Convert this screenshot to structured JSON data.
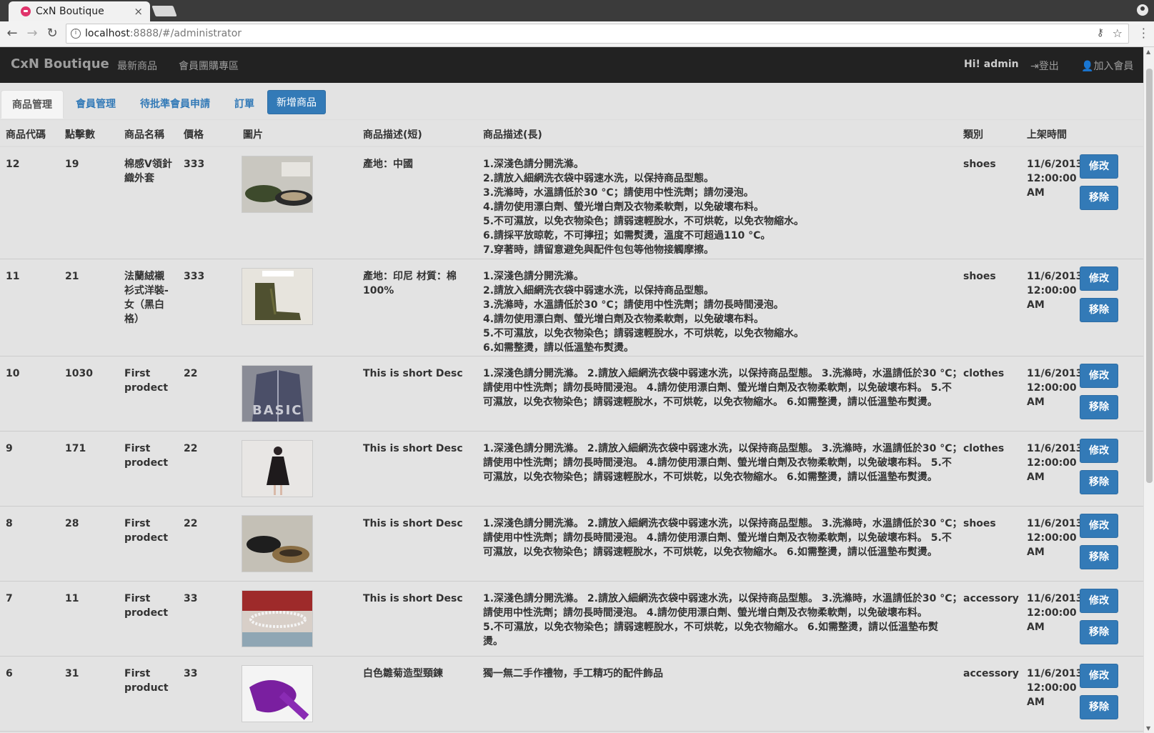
{
  "browser": {
    "tab_title": "CxN Boutique",
    "url_host": "localhost",
    "url_rest": ":8888/#/administrator"
  },
  "navbar": {
    "brand": "CxN Boutique",
    "links": [
      "最新商品",
      "會員團購專區"
    ],
    "greeting": "Hi! admin",
    "logout": "登出",
    "join": "加入會員"
  },
  "subtabs": {
    "items": [
      "商品管理",
      "會員管理",
      "待批準會員申請",
      "訂單"
    ],
    "add_button": "新增商品"
  },
  "table": {
    "headers": [
      "商品代碼",
      "點擊數",
      "商品名稱",
      "價格",
      "圖片",
      "商品描述(短)",
      "商品描述(長)",
      "類別",
      "上架時間"
    ],
    "edit_label": "修改",
    "remove_label": "移除",
    "rows": [
      {
        "id": "12",
        "clicks": "19",
        "name": [
          "棉感V領針",
          "織外套"
        ],
        "price": "333",
        "short": [
          "產地：中國"
        ],
        "long": [
          "1.深淺色請分開洗滌。",
          "2.請放入細網洗衣袋中弱速水洗，以保持商品型態。",
          "3.洗滌時，水溫請低於30 °C；請使用中性洗劑；請勿浸泡。",
          "4.請勿使用漂白劑、螢光增白劑及衣物柔軟劑，以免破壞布料。",
          "5.不可濕放，以免衣物染色；請弱速輕脫水，不可烘乾，以免衣物縮水。",
          "6.請採平放晾乾，不可擰扭；如需熨燙，溫度不可超過110 °C。",
          "7.穿著時，請留意避免與配件包包等他物接觸摩擦。"
        ],
        "category": "shoes",
        "date": [
          "11/6/2013,",
          "12:00:00",
          "AM"
        ],
        "image": "loafers-photo"
      },
      {
        "id": "11",
        "clicks": "21",
        "name": [
          "法蘭絨襯",
          "衫式洋裝-",
          "女（黑白",
          "格）"
        ],
        "price": "333",
        "short": [
          "產地：印尼 材質：棉",
          "100%"
        ],
        "long": [
          "1.深淺色請分開洗滌。",
          "2.請放入細網洗衣袋中弱速水洗，以保持商品型態。",
          "3.洗滌時，水溫請低於30 °C；請使用中性洗劑；請勿長時間浸泡。",
          "4.請勿使用漂白劑、螢光增白劑及衣物柔軟劑，以免破壞布料。",
          "5.不可濕放，以免衣物染色；請弱速輕脫水，不可烘乾，以免衣物縮水。",
          "6.如需整燙，請以低溫墊布熨燙。"
        ],
        "category": "shoes",
        "date": [
          "11/6/2013,",
          "12:00:00",
          "AM"
        ],
        "image": "boots-photo"
      },
      {
        "id": "10",
        "clicks": "1030",
        "name": [
          "First",
          "prodect"
        ],
        "price": "22",
        "short": [
          "This is short Desc"
        ],
        "long": [
          "1.深淺色請分開洗滌。 2.請放入細網洗衣袋中弱速水洗，以保持商品型態。 3.洗滌時，水溫請低於30 °C；",
          "請使用中性洗劑；請勿長時間浸泡。 4.請勿使用漂白劑、螢光增白劑及衣物柔軟劑，以免破壞布料。 5.不",
          "可濕放，以免衣物染色；請弱速輕脫水，不可烘乾，以免衣物縮水。 6.如需整燙，請以低溫墊布熨燙。"
        ],
        "category": "clothes",
        "date": [
          "11/6/2013,",
          "12:00:00",
          "AM"
        ],
        "image": "cardigan-photo",
        "photo_text": "BASIC"
      },
      {
        "id": "9",
        "clicks": "171",
        "name": [
          "First",
          "prodect"
        ],
        "price": "22",
        "short": [
          "This is short Desc"
        ],
        "long": [
          "1.深淺色請分開洗滌。 2.請放入細網洗衣袋中弱速水洗，以保持商品型態。 3.洗滌時，水溫請低於30 °C；",
          "請使用中性洗劑；請勿長時間浸泡。 4.請勿使用漂白劑、螢光增白劑及衣物柔軟劑，以免破壞布料。 5.不",
          "可濕放，以免衣物染色；請弱速輕脫水，不可烘乾，以免衣物縮水。 6.如需整燙，請以低溫墊布熨燙。"
        ],
        "category": "clothes",
        "date": [
          "11/6/2013,",
          "12:00:00",
          "AM"
        ],
        "image": "dress-photo"
      },
      {
        "id": "8",
        "clicks": "28",
        "name": [
          "First",
          "prodect"
        ],
        "price": "22",
        "short": [
          "This is short Desc"
        ],
        "long": [
          "1.深淺色請分開洗滌。 2.請放入細網洗衣袋中弱速水洗，以保持商品型態。 3.洗滌時，水溫請低於30 °C；",
          "請使用中性洗劑；請勿長時間浸泡。 4.請勿使用漂白劑、螢光增白劑及衣物柔軟劑，以免破壞布料。 5.不",
          "可濕放，以免衣物染色；請弱速輕脫水，不可烘乾，以免衣物縮水。 6.如需整燙，請以低溫墊布熨燙。"
        ],
        "category": "shoes",
        "date": [
          "11/6/2013,",
          "12:00:00",
          "AM"
        ],
        "image": "slipons-photo"
      },
      {
        "id": "7",
        "clicks": "11",
        "name": [
          "First",
          "prodect"
        ],
        "price": "33",
        "short": [
          "This is short Desc"
        ],
        "long": [
          "1.深淺色請分開洗滌。 2.請放入細網洗衣袋中弱速水洗，以保持商品型態。 3.洗滌時，水溫請低於30 °C；",
          "請使用中性洗劑；請勿長時間浸泡。 4.請勿使用漂白劑、螢光增白劑及衣物柔軟劑，以免破壞布料。",
          "5.不可濕放，以免衣物染色；請弱速輕脫水，不可烘乾，以免衣物縮水。 6.如需整燙，請以低溫墊布熨",
          "燙。"
        ],
        "category": "accessory",
        "date": [
          "11/6/2013,",
          "12:00:00",
          "AM"
        ],
        "image": "choker-photo"
      },
      {
        "id": "6",
        "clicks": "31",
        "name": [
          "First",
          "product"
        ],
        "price": "33",
        "short": [
          "白色雛菊造型頸鍊"
        ],
        "long": [
          "獨一無二手作禮物，手工精巧的配件飾品"
        ],
        "category": "accessory",
        "date": [
          "11/6/2013,",
          "12:00:00",
          "AM"
        ],
        "image": "scarf-photo"
      }
    ]
  }
}
